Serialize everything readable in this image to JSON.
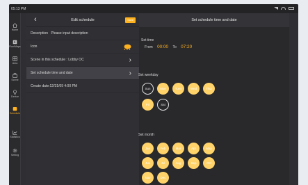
{
  "status": {
    "time": "05:13 PM"
  },
  "sidebar": {
    "items": [
      {
        "label": "Home",
        "icon": "home-icon"
      },
      {
        "label": "Run/Maps",
        "icon": "map-icon"
      },
      {
        "label": "Area",
        "icon": "area-icon"
      },
      {
        "label": "Scene",
        "icon": "scene-icon"
      },
      {
        "label": "Device",
        "icon": "device-icon"
      },
      {
        "label": "Schedule",
        "icon": "schedule-icon",
        "active": true
      },
      {
        "label": "Statistics",
        "icon": "statistics-icon"
      },
      {
        "label": "Setting",
        "icon": "setting-icon"
      }
    ]
  },
  "left": {
    "title": "Edit schedule",
    "save_label": "Save",
    "description_label": "Description",
    "description_placeholder": "Please input description",
    "icon_label": "Icon",
    "scene_label": "Scene in this schedule : Lobby OC",
    "time_date_label": "Set schedule time and date",
    "create_date": "Create date:12/31/69 4:00 PM"
  },
  "right": {
    "title": "Set schedule time and date",
    "set_time_label": "Set time",
    "from_label": "From",
    "from_value": "00:00",
    "to_label": "To",
    "to_value": "07:20",
    "weekday_label": "Set weekday",
    "weekdays": [
      {
        "label": "Sun",
        "on": false
      },
      {
        "label": "Mon",
        "on": true
      },
      {
        "label": "Tues",
        "on": true
      },
      {
        "label": "Wed",
        "on": true
      },
      {
        "label": "Thur",
        "on": true
      },
      {
        "label": "Fri",
        "on": true
      },
      {
        "label": "Sat",
        "on": false
      }
    ],
    "month_label": "Set month",
    "months": [
      "Jan",
      "Feb",
      "Mar",
      "Apr",
      "May",
      "Jun",
      "Jul",
      "Aug",
      "Sep",
      "Oct",
      "Nov",
      "Dec"
    ]
  },
  "colors": {
    "accent": "#ffb21f",
    "selected_circle": "#ffd36a",
    "background": "#2f2f33"
  }
}
